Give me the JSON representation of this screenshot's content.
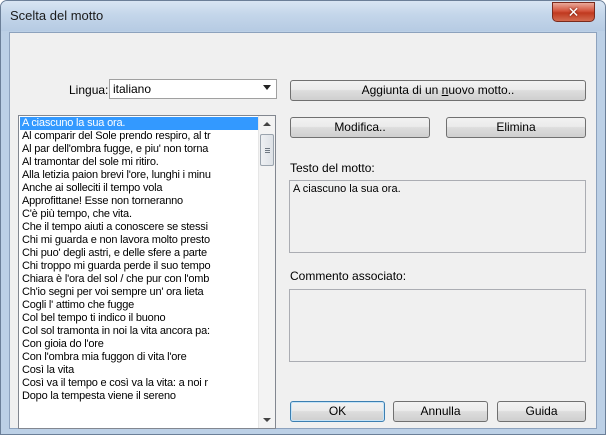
{
  "window": {
    "title": "Scelta del motto",
    "close_glyph": "✕"
  },
  "lingua": {
    "label": "Lingua:",
    "selected": "italiano"
  },
  "mottos": [
    "A ciascuno la sua ora.",
    "Al comparir del Sole prendo respiro, al tr",
    "Al par dell'ombra fugge, e piu' non torna",
    "Al tramontar del sole mi ritiro.",
    "Alla letizia paion brevi l'ore, lunghi i minu",
    "Anche ai solleciti il tempo vola",
    "Approfittane! Esse non torneranno",
    "C'è più tempo, che vita.",
    "Che il tempo aiuti a conoscere se stessi",
    "Chi mi guarda e non lavora molto presto",
    "Chi puo' degli astri, e delle sfere a parte",
    "Chi troppo mi guarda perde il suo tempo",
    "Chiara è l'ora del sol / che pur con l'omb",
    "Ch'io segni per voi sempre un' ora lieta",
    "Cogli l' attimo che fugge",
    "Col bel tempo ti indico il buono",
    "Col sol tramonta in noi la vita ancora pa:",
    "Con gioia do l'ore",
    "Con l'ombra mia fuggon di vita l'ore",
    "Così la vita",
    "Così va il tempo e così va la vita: a noi r",
    "Dopo la tempesta viene il sereno"
  ],
  "buttons": {
    "add_new_prefix": "Aggiunta di un ",
    "add_new_mnemonic": "n",
    "add_new_suffix": "uovo motto..",
    "modify": "Modifica..",
    "delete": "Elimina",
    "ok": "OK",
    "cancel": "Annulla",
    "help": "Guida"
  },
  "motto_text": {
    "label": "Testo del motto:",
    "value": "A ciascuno la sua ora."
  },
  "comment": {
    "label": "Commento associato:",
    "value": ""
  }
}
